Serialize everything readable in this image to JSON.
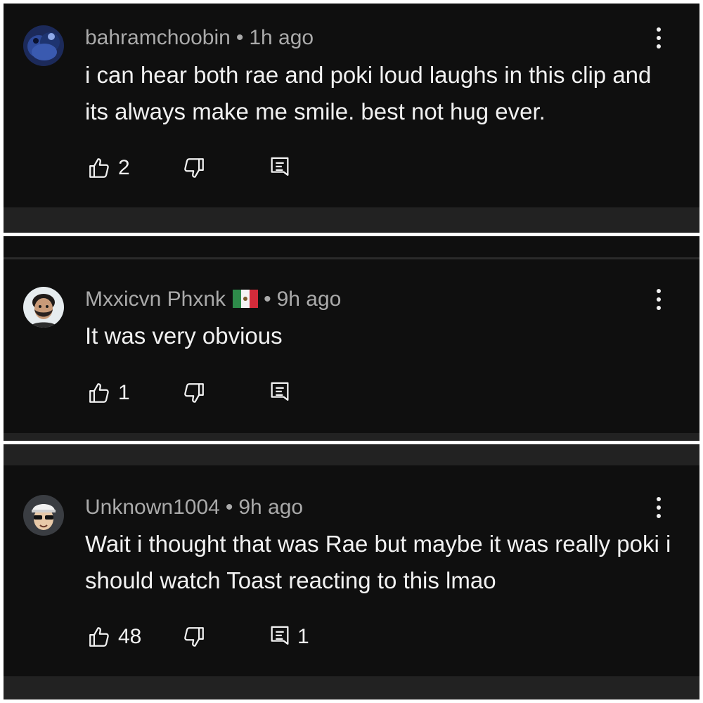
{
  "comments": [
    {
      "author": "bahramchoobin",
      "time": "1h ago",
      "flag": "",
      "text": "i can hear both rae and poki loud laughs in this clip and its always make me smile. best not hug ever.",
      "likes": "2",
      "replies": "",
      "avatar_icon": "dark-blue-figure-avatar"
    },
    {
      "author": "Mxxicvn Phxnk",
      "time": "9h ago",
      "flag": "mexico-flag",
      "text": "It was very obvious",
      "likes": "1",
      "replies": "",
      "avatar_icon": "bearded-man-avatar"
    },
    {
      "author": "Unknown1004",
      "time": "9h ago",
      "flag": "",
      "text": "Wait i thought that was Rae but maybe it was really poki i should watch Toast reacting to this lmao",
      "likes": "48",
      "replies": "1",
      "avatar_icon": "cartoon-man-cap-sunglasses-avatar"
    }
  ],
  "icons": {
    "like": "thumb-up-icon",
    "dislike": "thumb-down-icon",
    "reply": "reply-comment-icon",
    "more": "more-vertical-icon"
  },
  "colors": {
    "background": "#0f0f0f",
    "author_text": "#aaaaaa",
    "body_text": "#f1f1f1",
    "separator_strip": "#222222"
  }
}
